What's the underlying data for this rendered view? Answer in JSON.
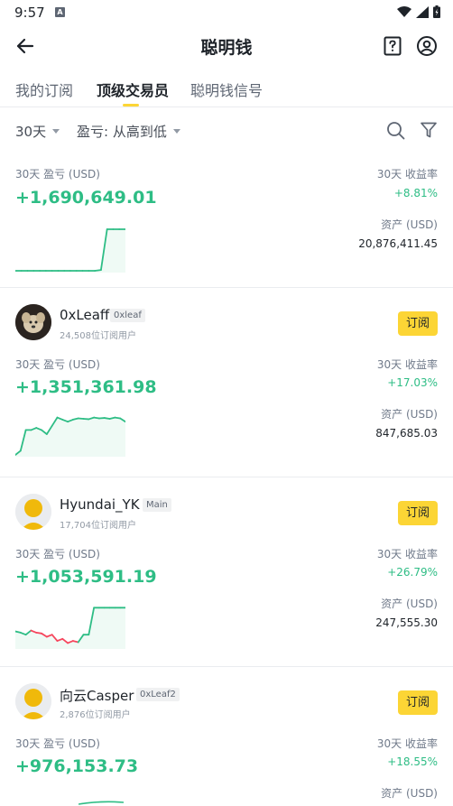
{
  "status_bar": {
    "time": "9:57",
    "sim_label": "A"
  },
  "app_bar": {
    "title": "聪明钱"
  },
  "tabs": [
    {
      "label": "我的订阅",
      "active": false
    },
    {
      "label": "顶级交易员",
      "active": true
    },
    {
      "label": "聪明钱信号",
      "active": false
    }
  ],
  "filters": {
    "period": "30天",
    "sort": "盈亏: 从高到低"
  },
  "labels": {
    "pnl": "30天 盈亏 (USD)",
    "roi": "30天 收益率",
    "assets": "资产 (USD)",
    "subscribe": "订阅"
  },
  "colors": {
    "accent": "#fcd535",
    "positive": "#2ebd85",
    "negative": "#f6465d"
  },
  "traders": [
    {
      "name": "",
      "tag": "",
      "subscribers": "",
      "pnl": "+1,690,649.01",
      "roi": "+8.81%",
      "assets": "20,876,411.45",
      "sparkline": [
        0,
        0,
        0,
        0,
        0,
        0,
        0,
        0,
        0,
        0,
        0,
        0,
        0,
        0,
        0.02,
        1,
        1,
        1,
        1
      ]
    },
    {
      "name": "0xLeaff",
      "tag": "0xleaf",
      "subscribers": "24,508位订阅用户",
      "pnl": "+1,351,361.98",
      "roi": "+17.03%",
      "assets": "847,685.03",
      "avatar": "dog-photo",
      "sparkline": [
        0,
        0.1,
        0.6,
        0.6,
        0.65,
        0.6,
        0.5,
        0.7,
        0.9,
        0.85,
        0.8,
        0.85,
        0.88,
        0.87,
        0.86,
        0.9,
        0.88,
        0.89,
        0.87,
        0.9,
        0.88,
        0.8
      ]
    },
    {
      "name": "Hyundai_YK",
      "tag": "Main",
      "subscribers": "17,704位订阅用户",
      "pnl": "+1,053,591.19",
      "roi": "+26.79%",
      "assets": "247,555.30",
      "avatar": "yellow-coin",
      "sparkline": [
        0.38,
        0.35,
        0.3,
        0.4,
        0.35,
        0.33,
        0.25,
        0.3,
        0.15,
        0.2,
        0.1,
        0.15,
        0.12,
        0.3,
        0.3,
        0.95,
        0.95,
        0.95,
        0.95,
        0.95,
        0.95,
        0.95
      ],
      "negative_range": [
        3,
        12
      ]
    },
    {
      "name": "向云Casper",
      "tag": "0xLeaf2",
      "subscribers": "2,876位订阅用户",
      "pnl": "+976,153.73",
      "roi": "+18.55%",
      "assets": "",
      "avatar": "yellow-coin",
      "sparkline": []
    }
  ]
}
